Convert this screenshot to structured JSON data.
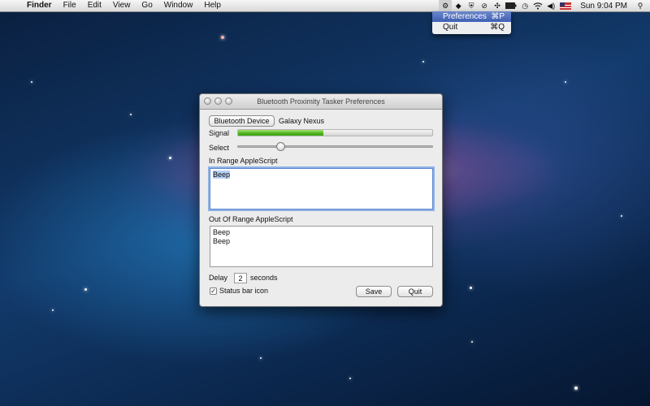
{
  "menubar": {
    "apple": "",
    "items": [
      "Finder",
      "File",
      "Edit",
      "View",
      "Go",
      "Window",
      "Help"
    ],
    "status_icons": [
      "gear-icon",
      "dropbox-icon",
      "shield-icon",
      "no-symbol-icon",
      "bluetooth-icon",
      "battery-icon",
      "time-machine-icon",
      "wifi-icon",
      "volume-icon",
      "input-flag-icon"
    ],
    "clock": "Sun 9:04 PM"
  },
  "dropdown": {
    "items": [
      {
        "label": "Preferences",
        "shortcut": "⌘P"
      },
      {
        "label": "Quit",
        "shortcut": "⌘Q"
      }
    ]
  },
  "window": {
    "title": "Bluetooth Proximity Tasker Preferences",
    "device_button": "Bluetooth Device",
    "device_name": "Galaxy Nexus",
    "signal_label": "Signal",
    "signal_level": 0.44,
    "select_label": "Select",
    "select_value": 0.22,
    "in_range_label": "In Range AppleScript",
    "in_range_script": [
      "Beep"
    ],
    "out_range_label": "Out Of Range AppleScript",
    "out_range_script": [
      "Beep",
      "Beep"
    ],
    "delay_label": "Delay",
    "delay_value": "2",
    "delay_unit": "seconds",
    "status_bar_label": "Status bar icon",
    "status_bar_checked": "✓",
    "save_button": "Save",
    "quit_button": "Quit"
  }
}
